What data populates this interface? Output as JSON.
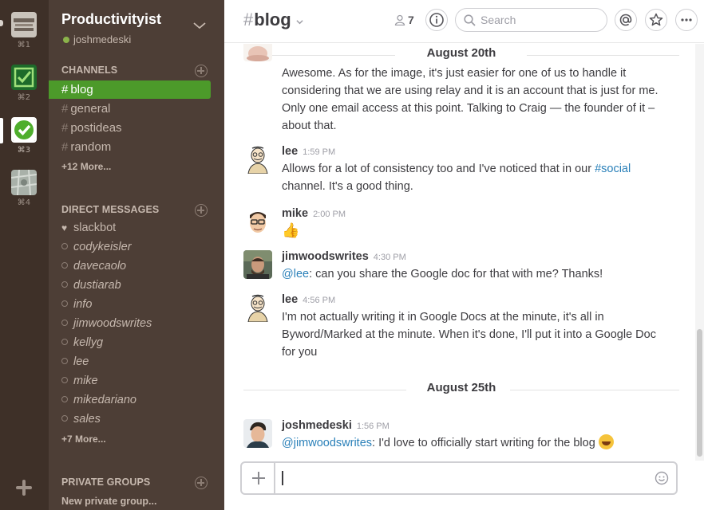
{
  "teams": [
    {
      "key": "⌘1",
      "icon": "team-medium-logo-icon"
    },
    {
      "key": "⌘2",
      "icon": "team-checkbox-logo-icon"
    },
    {
      "key": "⌘3",
      "icon": "team-productivityist-logo-icon",
      "active": true
    },
    {
      "key": "⌘4",
      "icon": "team-map-logo-icon"
    }
  ],
  "sidebar": {
    "team_name": "Productivityist",
    "username": "joshmedeski",
    "channels_title": "CHANNELS",
    "channels": [
      "blog",
      "general",
      "postideas",
      "random"
    ],
    "active_channel": "blog",
    "channels_more": "+12 More...",
    "dm_title": "DIRECT MESSAGES",
    "dms": [
      "slackbot",
      "codykeisler",
      "davecaolo",
      "dustiarab",
      "info",
      "jimwoodswrites",
      "kellyg",
      "lee",
      "mike",
      "mikedariano",
      "sales"
    ],
    "dm_more": "+7 More...",
    "groups_title": "PRIVATE GROUPS",
    "new_group": "New private group..."
  },
  "header": {
    "hash": "#",
    "channel": "blog",
    "member_count": "7",
    "search_placeholder": "Search"
  },
  "messages": {
    "day1": "August 20th",
    "day2": "August 25th",
    "m0_lines": [
      "Awesome. As for the image, it's just easier for one of us to handle it",
      "considering that we are using relay and it is an account that is just for me.",
      "Only one email access at this point. Talking to Craig — the founder of it –",
      "about that."
    ],
    "m1": {
      "author": "lee",
      "time": "1:59 PM",
      "l1a": "Allows for a lot of consistency too and I've noticed that in our ",
      "l1link": "#social",
      "l2": "channel. It's a good thing."
    },
    "m2": {
      "author": "mike",
      "time": "2:00 PM",
      "emoji": "👍"
    },
    "m3": {
      "author": "jimwoodswrites",
      "time": "4:30 PM",
      "mention": "@lee",
      "text": ":  can you share the Google doc for that with me? Thanks!"
    },
    "m4": {
      "author": "lee",
      "time": "4:56 PM",
      "lines": [
        "I'm not actually writing it in Google Docs at the minute, it's all in",
        "Byword/Marked at the minute. When it's done, I'll put it into a Google Doc",
        "for you"
      ]
    },
    "m5": {
      "author": "joshmedeski",
      "time": "1:56 PM",
      "mention": "@jimwoodswrites",
      "text": ": I'd love to officially start writing for the blog"
    }
  },
  "composer": {
    "value": ""
  }
}
